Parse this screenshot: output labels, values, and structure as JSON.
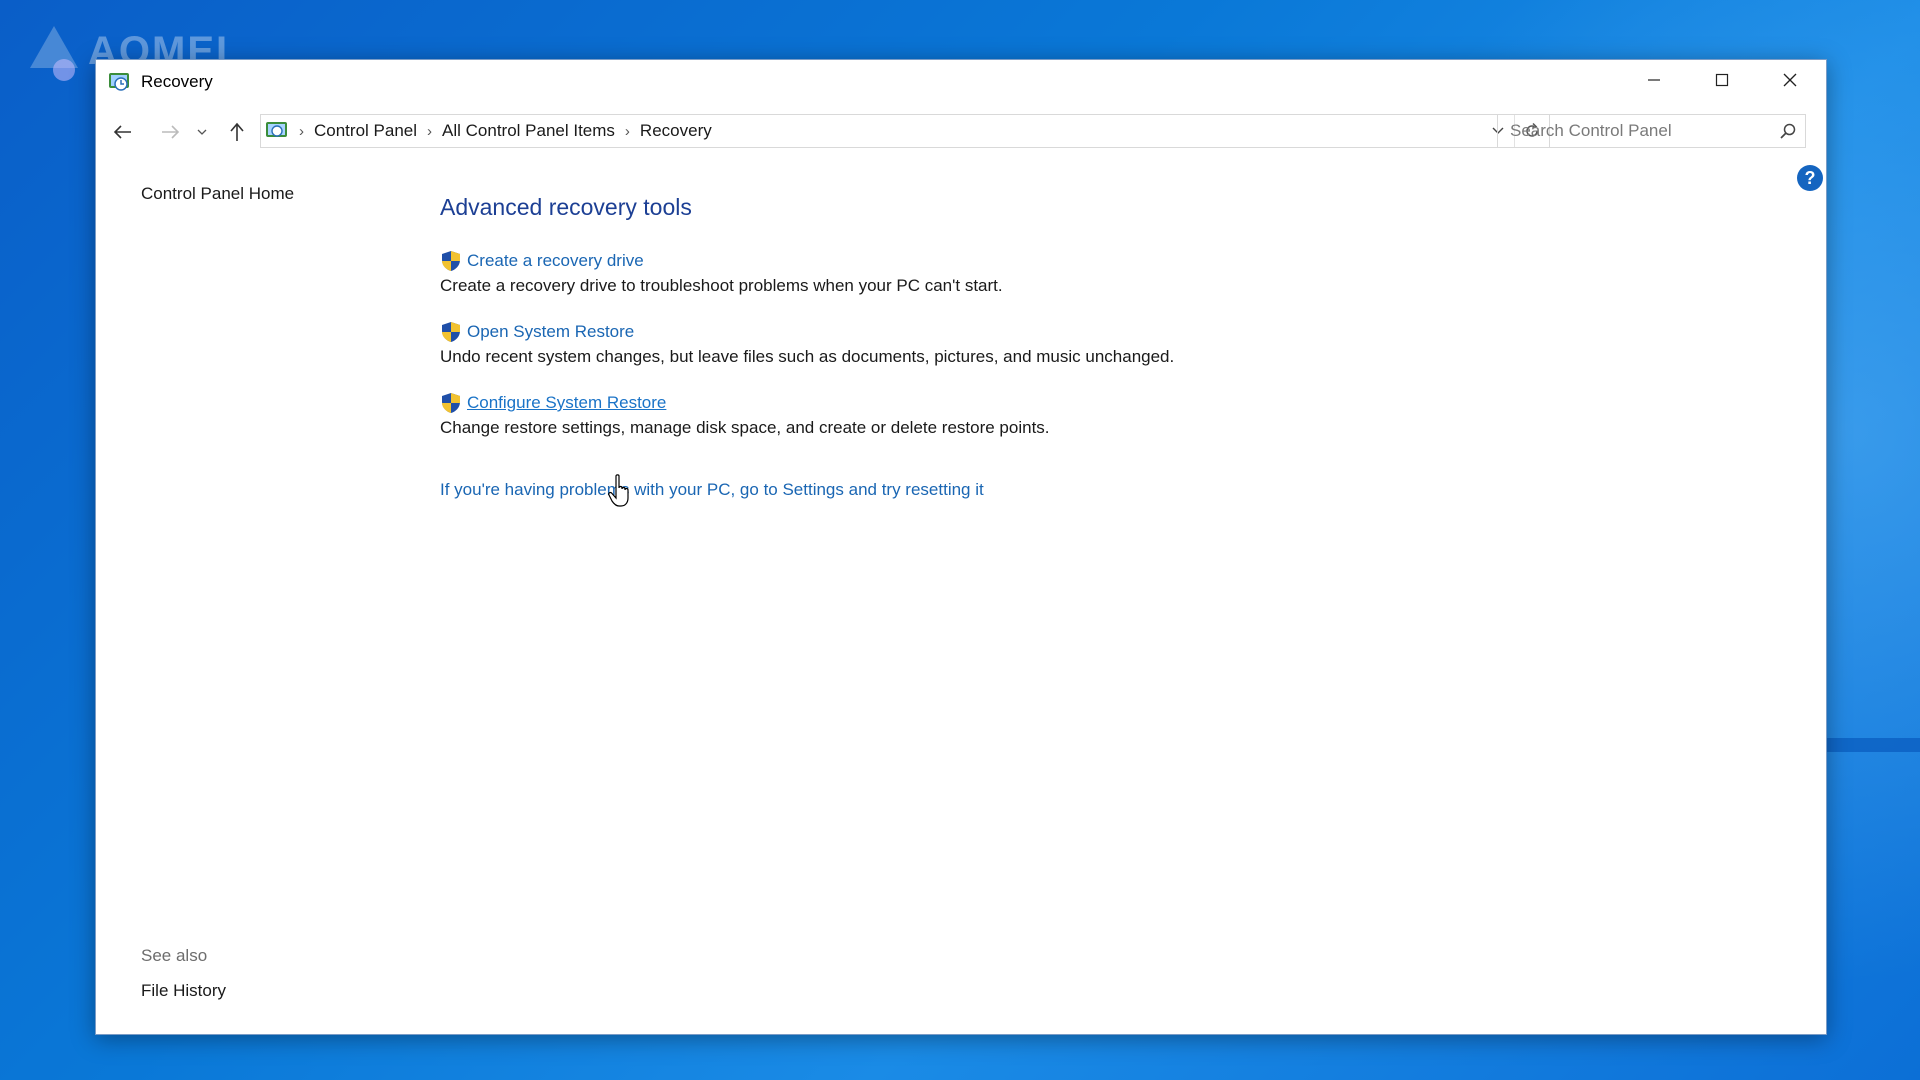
{
  "watermark": {
    "text": "AOMEI"
  },
  "window": {
    "title": "Recovery"
  },
  "titlebar": {
    "minimize_glyph": "—",
    "maximize_glyph": "☐",
    "close_glyph": "✕"
  },
  "address": {
    "crumbs": [
      "Control Panel",
      "All Control Panel Items",
      "Recovery"
    ]
  },
  "search": {
    "placeholder": "Search Control Panel"
  },
  "sidebar": {
    "home": "Control Panel Home",
    "see_also": "See also",
    "file_history": "File History"
  },
  "main": {
    "heading": "Advanced recovery tools",
    "tools": [
      {
        "link": "Create a recovery drive",
        "desc": "Create a recovery drive to troubleshoot problems when your PC can't start."
      },
      {
        "link": "Open System Restore",
        "desc": "Undo recent system changes, but leave files such as documents, pictures, and music unchanged."
      },
      {
        "link": "Configure System Restore",
        "desc": "Change restore settings, manage disk space, and create or delete restore points."
      }
    ],
    "reset_link": "If you're having problems with your PC, go to Settings and try resetting it"
  },
  "colors": {
    "link": "#1a66b3",
    "heading": "#1c3f94",
    "desktop": "#0a78d7"
  }
}
